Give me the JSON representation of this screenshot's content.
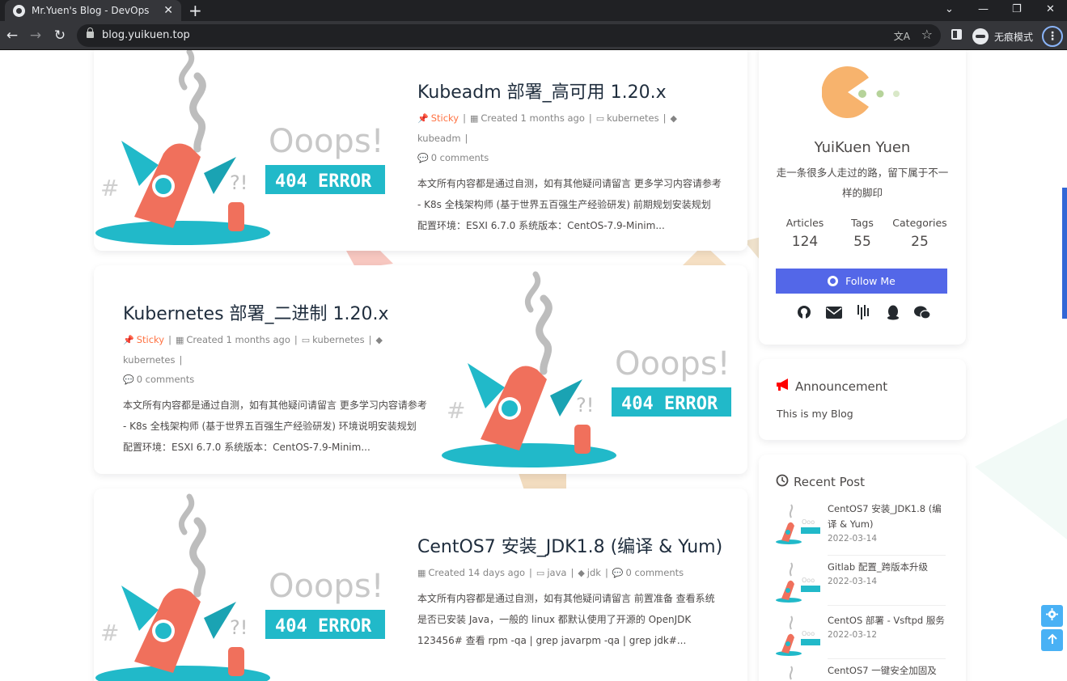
{
  "browser": {
    "tab_title": "Mr.Yuen's Blog - DevOps",
    "tab_close": "✕",
    "new_tab": "+",
    "url": "blog.yuikuen.top",
    "profile_label": "无痕模式",
    "window_controls": [
      "⌄",
      "—",
      "❐",
      "✕"
    ],
    "nav": {
      "back": "←",
      "forward": "→",
      "reload": "↻"
    },
    "translate_glyph": "文A",
    "star": "☆",
    "menu": "⋮"
  },
  "illustration": {
    "text_ooops": "Ooops!",
    "text_404": "404 ERROR"
  },
  "posts": [
    {
      "title": "Kubeadm 部署_高可用 1.20.x",
      "sticky": "Sticky",
      "created": "Created 1 months ago",
      "category": "kubernetes",
      "tag": "kubeadm",
      "comments": "0 comments",
      "excerpt": "本文所有内容都是通过自测，如有其他疑问请留言 更多学习内容请参考 - K8s 全栈架构师 (基于世界五百强生产经验研发) 前期规划安装规划 配置环境：ESXI 6.7.0 系统版本：CentOS-7.9-Minim..."
    },
    {
      "title": "Kubernetes 部署_二进制 1.20.x",
      "sticky": "Sticky",
      "created": "Created 1 months ago",
      "category": "kubernetes",
      "tag": "kubernetes",
      "comments": "0 comments",
      "excerpt": "本文所有内容都是通过自测，如有其他疑问请留言 更多学习内容请参考 - K8s 全栈架构师 (基于世界五百强生产经验研发) 环境说明安装规划 配置环境：ESXI 6.7.0 系统版本：CentOS-7.9-Minim..."
    },
    {
      "title": "CentOS7 安装_JDK1.8 (编译 & Yum)",
      "created": "Created 14 days ago",
      "category": "java",
      "tag": "jdk",
      "comments": "0 comments",
      "excerpt": "本文所有内容都是通过自测，如有其他疑问请留言 前置准备 查看系统是否已安装 Java，一般的 linux 都默认使用了开源的 OpenJDK 123456# 查看 rpm -qa | grep javarpm -qa | grep jdk#..."
    }
  ],
  "author": {
    "name": "YuiKuen Yuen",
    "description": "走一条很多人走过的路，留下属于不一样的脚印",
    "stats": [
      {
        "label": "Articles",
        "value": "124"
      },
      {
        "label": "Tags",
        "value": "55"
      },
      {
        "label": "Categories",
        "value": "25"
      }
    ],
    "follow_label": "Follow Me",
    "social_icons": [
      "github-icon",
      "mail-icon",
      "gitee-icon",
      "qq-icon",
      "wechat-icon"
    ]
  },
  "announcement": {
    "heading": "Announcement",
    "text": "This is my Blog"
  },
  "recent": {
    "heading": "Recent Post",
    "items": [
      {
        "title": "CentOS7 安装_JDK1.8 (编译 & Yum)",
        "date": "2022-03-14"
      },
      {
        "title": "Gitlab 配置_跨版本升级",
        "date": "2022-03-14"
      },
      {
        "title": "CentOS 部署 - Vsftpd 服务",
        "date": "2022-03-12"
      },
      {
        "title": "CentOS7 一键安全加固及",
        "date": ""
      }
    ]
  },
  "colors": {
    "accent": "#49b1f5",
    "follow_button": "#5367e8",
    "sticky": "#ff7242",
    "rocket_red": "#f0705c",
    "rocket_teal": "#21b9c9",
    "pacman": "#f7b36d"
  }
}
